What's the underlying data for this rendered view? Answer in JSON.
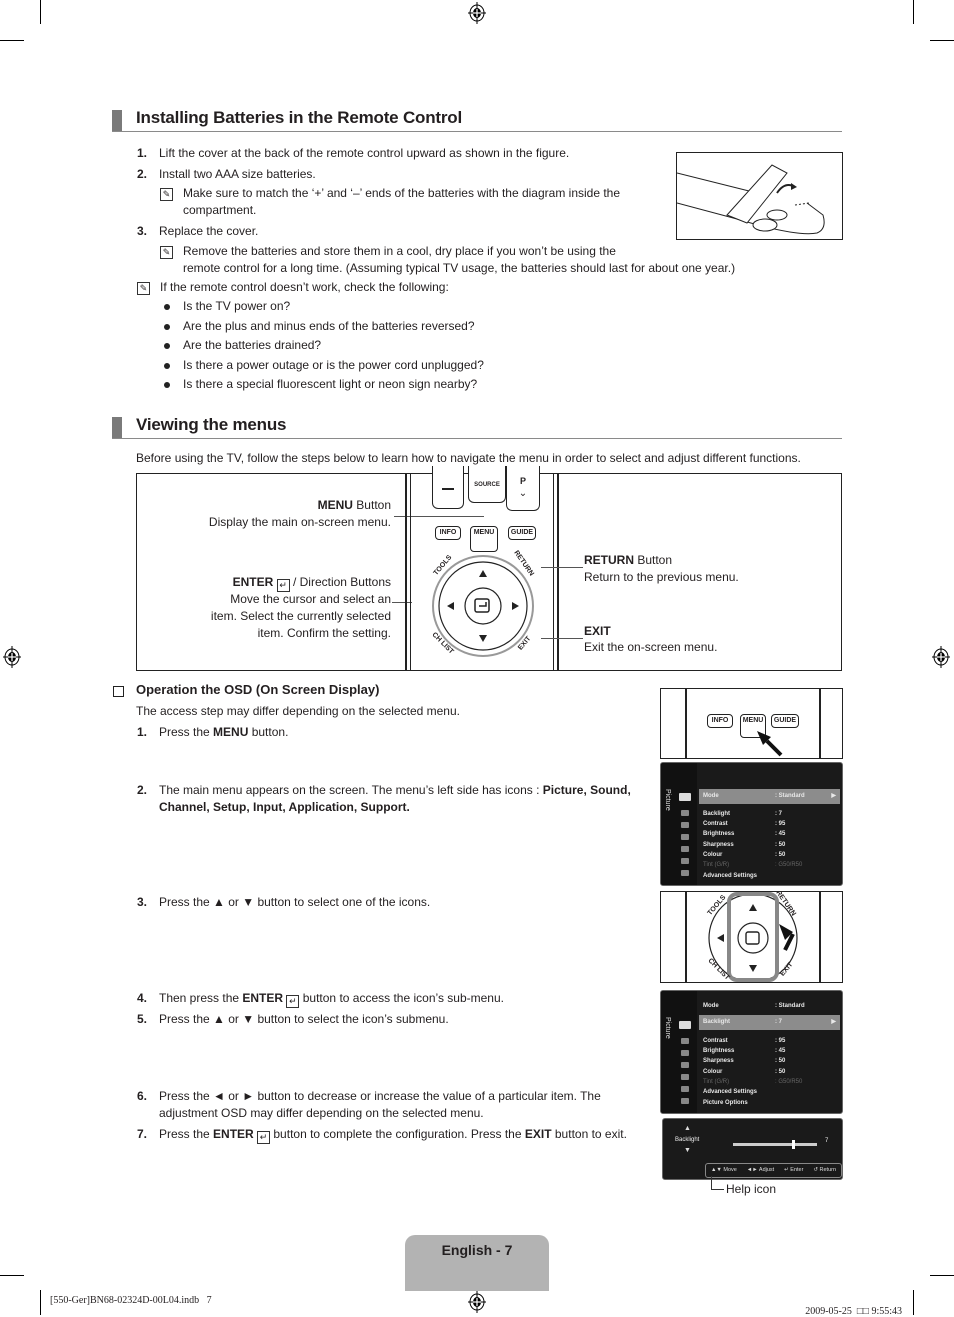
{
  "section1": {
    "title": "Installing Batteries in the Remote Control",
    "steps": [
      {
        "num": "1.",
        "text": "Lift the cover at the back of the remote control upward as shown in the figure."
      },
      {
        "num": "2.",
        "text": "Install two AAA size batteries."
      },
      {
        "num": "3.",
        "text": "Replace the cover."
      }
    ],
    "note_step2_line1": "Make sure to match the ‘+’ and ‘–’ ends of the batteries with the diagram inside the",
    "note_step2_line2": "compartment.",
    "note_step3_line1": "Remove the batteries and store them in a cool, dry place if you won’t be using the",
    "note_step3_line2": "remote control for a long time. (Assuming typical TV usage, the batteries should last for about one year.)",
    "note_check": "If the remote control doesn’t work, check the following:",
    "bullets": [
      "Is the TV power on?",
      "Are the plus and minus ends of the batteries reversed?",
      "Are the batteries drained?",
      "Is there a power outage or is the power cord unplugged?",
      "Is there a special fluorescent light or neon sign nearby?"
    ],
    "figure_icon": "remote-battery-cover-illustration"
  },
  "section2": {
    "title": "Viewing the menus",
    "intro": "Before using the TV, follow the steps below to learn how to navigate the menu in order to select and adjust different functions.",
    "diagram": {
      "menu_title_bold": "MENU",
      "menu_title_rest": " Button",
      "menu_desc": "Display the main on-screen menu.",
      "enter_title_bold": "ENTER",
      "enter_title_rest": " / Direction Buttons",
      "enter_desc_lines": [
        "Move the cursor and select an",
        "item. Select the currently selected",
        "item. Confirm the setting."
      ],
      "return_title_bold": "RETURN",
      "return_title_rest": " Button",
      "return_desc": "Return to the previous menu.",
      "exit_title_bold": "EXIT",
      "exit_desc": "Exit the on-screen menu.",
      "remote_buttons": {
        "source": "SOURCE",
        "p": "P",
        "info": "INFO",
        "menu": "MENU",
        "guide": "GUIDE",
        "tools": "TOOLS",
        "return": "RETURN",
        "ch_list": "CH LIST",
        "exit": "EXIT"
      }
    }
  },
  "osd": {
    "subtitle": "Operation the OSD (On Screen Display)",
    "intro": "The access step may differ depending on the selected menu.",
    "step1": {
      "num": "1.",
      "pre": "Press the ",
      "bold": "MENU",
      "post": " button."
    },
    "step2": {
      "num": "2.",
      "line1_pre": "The main menu appears on the screen. The menu’s left side has icons : ",
      "line1_bold": "Picture, Sound,",
      "line2_bold": "Channel, Setup, Input, Application, Support."
    },
    "step3": {
      "num": "3.",
      "text": "Press the ▲ or ▼ button to select one of the icons."
    },
    "step4": {
      "num": "4.",
      "pre": "Then press the ",
      "bold": "ENTER",
      "post": " button to access the icon’s sub-menu."
    },
    "step5": {
      "num": "5.",
      "text": "Press the ▲ or ▼ button to select the icon’s submenu."
    },
    "step6": {
      "num": "6.",
      "line1": "Press the ◄ or ► button to decrease or increase the value of a particular item. The",
      "line2": "adjustment OSD may differ depending on the selected menu."
    },
    "step7": {
      "num": "7.",
      "pre": "Press the ",
      "bold": "ENTER",
      "mid": " button to complete the configuration. Press the ",
      "bold2": "EXIT",
      "post": " button to exit."
    },
    "menu1": {
      "side_label": "Picture",
      "highlight": {
        "label": "Mode",
        "value": ": Standard"
      },
      "rows": [
        {
          "label": "Backlight",
          "value": ": 7"
        },
        {
          "label": "Contrast",
          "value": ": 95"
        },
        {
          "label": "Brightness",
          "value": ": 45"
        },
        {
          "label": "Sharpness",
          "value": ": 50"
        },
        {
          "label": "Colour",
          "value": ": 50"
        },
        {
          "label": "Tint (G/R)",
          "value": ": G50/R50",
          "dim": true
        },
        {
          "label": "Advanced Settings",
          "value": ""
        }
      ]
    },
    "menu2": {
      "side_label": "Picture",
      "top": {
        "label": "Mode",
        "value": ": Standard"
      },
      "highlight": {
        "label": "Backlight",
        "value": ": 7"
      },
      "rows": [
        {
          "label": "Contrast",
          "value": ": 95"
        },
        {
          "label": "Brightness",
          "value": ": 45"
        },
        {
          "label": "Sharpness",
          "value": ": 50"
        },
        {
          "label": "Colour",
          "value": ": 50"
        },
        {
          "label": "Tint (G/R)",
          "value": ": G50/R50",
          "dim": true
        },
        {
          "label": "Advanced Settings",
          "value": ""
        },
        {
          "label": "Picture Options",
          "value": ""
        }
      ]
    },
    "adjust": {
      "label": "Backlight",
      "value": "7",
      "level_fraction": 0.7,
      "help": [
        {
          "icon": "▲▼",
          "label": "Move"
        },
        {
          "icon": "◄►",
          "label": "Adjust"
        },
        {
          "icon": "↵",
          "label": "Enter"
        },
        {
          "icon": "↺",
          "label": "Return"
        }
      ]
    },
    "help_icon_label": "Help icon"
  },
  "footer": {
    "page_label": "English - 7",
    "file_info": "[550-Ger]BN68-02324D-00L04.indb   7",
    "date": "2009-05-25",
    "time": "□□ 9:55:43"
  }
}
